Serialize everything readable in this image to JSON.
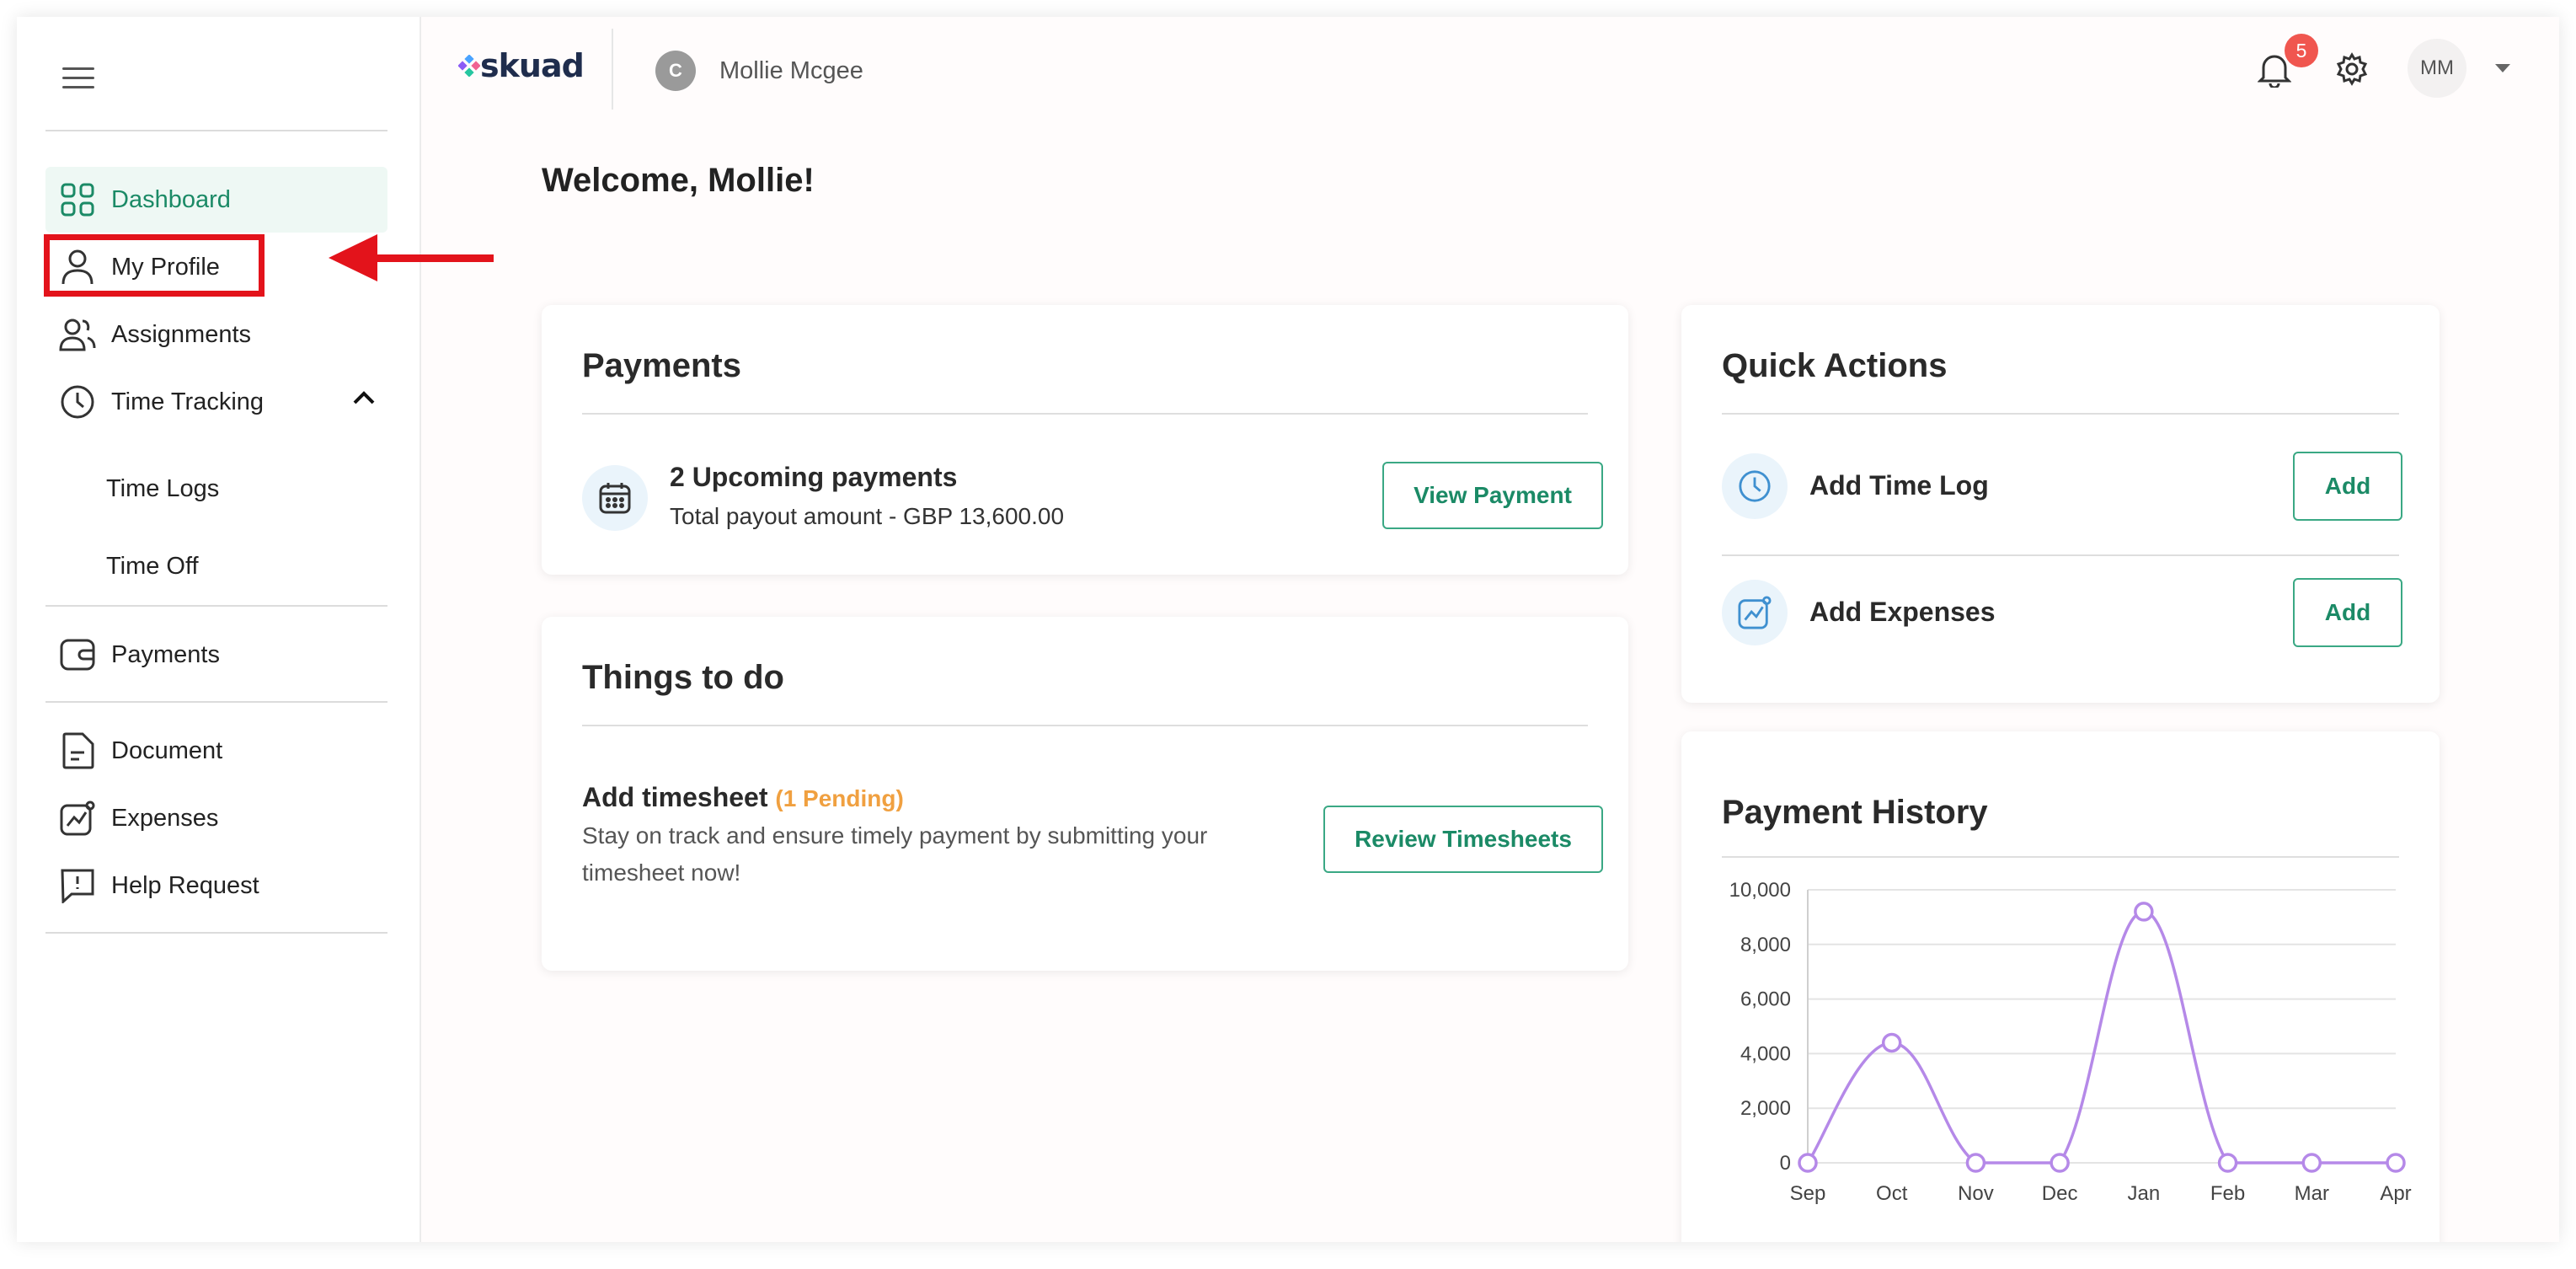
{
  "sidebar": {
    "items": [
      {
        "label": "Dashboard",
        "icon": "dashboard-grid-icon"
      },
      {
        "label": "My Profile",
        "icon": "user-icon"
      },
      {
        "label": "Assignments",
        "icon": "users-icon"
      },
      {
        "label": "Time Tracking",
        "icon": "clock-icon"
      },
      {
        "label": "Payments",
        "icon": "wallet-icon"
      },
      {
        "label": "Document",
        "icon": "document-icon"
      },
      {
        "label": "Expenses",
        "icon": "chart-icon"
      },
      {
        "label": "Help Request",
        "icon": "help-chat-icon"
      }
    ],
    "sub_items": [
      "Time Logs",
      "Time Off"
    ],
    "accent": "#1b8a66",
    "highlight_color": "#e3131b"
  },
  "header": {
    "logo_text": "skuad",
    "org_initial": "C",
    "org_name": "Mollie Mcgee",
    "notification_count": "5",
    "user_initials": "MM"
  },
  "main": {
    "welcome": "Welcome, Mollie!",
    "payments": {
      "title": "Payments",
      "upcoming": "2 Upcoming payments",
      "total": "Total payout amount - GBP 13,600.00",
      "button": "View Payment"
    },
    "todo": {
      "title": "Things to do",
      "item_title": "Add timesheet",
      "pending": "(1 Pending)",
      "description": "Stay on track and ensure timely payment by submitting your timesheet now!",
      "button": "Review Timesheets"
    },
    "quick_actions": {
      "title": "Quick Actions",
      "items": [
        {
          "label": "Add Time Log",
          "button": "Add",
          "icon": "clock-icon"
        },
        {
          "label": "Add Expenses",
          "button": "Add",
          "icon": "chart-icon"
        }
      ]
    },
    "payment_history": {
      "title": "Payment History"
    }
  },
  "chart_data": {
    "type": "line",
    "categories": [
      "Sep",
      "Oct",
      "Nov",
      "Dec",
      "Jan",
      "Feb",
      "Mar",
      "Apr"
    ],
    "series": [
      {
        "values": [
          0,
          4400,
          0,
          0,
          9200,
          0,
          0,
          0
        ]
      }
    ],
    "y_ticks": [
      "0",
      "2,000",
      "4,000",
      "6,000",
      "8,000",
      "10,000"
    ],
    "ylim": [
      0,
      10000
    ],
    "grid": true,
    "color": "#b589e8"
  }
}
